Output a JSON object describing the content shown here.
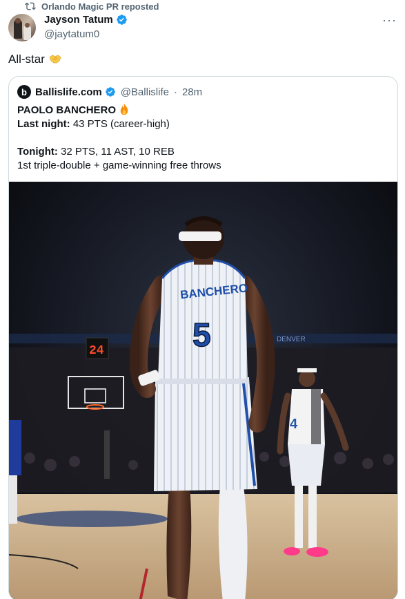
{
  "repost": {
    "text": "Orlando Magic PR reposted"
  },
  "author": {
    "display_name": "Jayson Tatum",
    "handle": "@jaytatum0"
  },
  "tweet": {
    "text": "All-star"
  },
  "quote": {
    "account_name": "Ballislife.com",
    "handle": "@Ballislife",
    "separator": "·",
    "time": "28m",
    "logo_letter": "b",
    "line1": "PAOLO BANCHERO",
    "line2_label": "Last night:",
    "line2_value": " 43 PTS (career-high)",
    "line3_label": "Tonight:",
    "line3_value": " 32 PTS, 11 AST, 10 REB",
    "line4": "1st triple-double + game-winning free throws"
  },
  "photo": {
    "jersey_name": "BANCHERO",
    "jersey_number": "5",
    "teammate_number": "4",
    "scoreboard": "24",
    "banner_text": "DENVER"
  },
  "colors": {
    "verified": "#1d9bf0",
    "secondary_text": "#536471",
    "border": "#cfd9de",
    "magic_blue": "#1f4fa8"
  },
  "icons": {
    "repost": "repost-icon",
    "verified": "verified-badge-icon",
    "more": "more-icon"
  }
}
